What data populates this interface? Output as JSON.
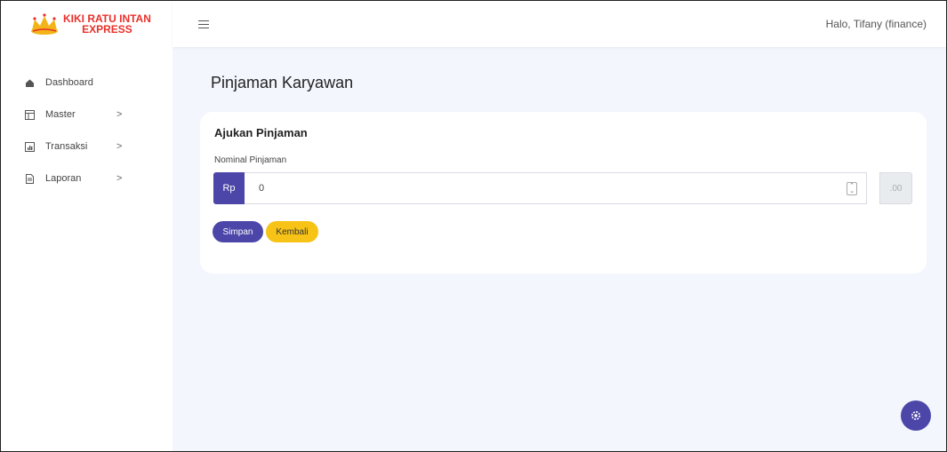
{
  "brand": {
    "line1": "KIKI RATU INTAN",
    "line2": "EXPRESS",
    "color": "#e8312b"
  },
  "header": {
    "greeting": "Halo,  Tifany (finance)"
  },
  "sidebar": {
    "items": [
      {
        "label": "Dashboard",
        "icon": "home-icon",
        "has_chevron": false
      },
      {
        "label": "Master",
        "icon": "table-icon",
        "has_chevron": true
      },
      {
        "label": "Transaksi",
        "icon": "chart-icon",
        "has_chevron": true
      },
      {
        "label": "Laporan",
        "icon": "document-icon",
        "has_chevron": true
      }
    ],
    "chevron": ">"
  },
  "main": {
    "page_title": "Pinjaman Karyawan",
    "card_title": "Ajukan Pinjaman",
    "field_label": "Nominal Pinjaman",
    "currency_prefix": "Rp",
    "amount_value": "0",
    "decimal_suffix": ".00",
    "save_label": "Simpan",
    "back_label": "Kembali"
  },
  "colors": {
    "primary": "#4b46a8",
    "warning": "#f7c316",
    "background": "#f3f6fd"
  }
}
